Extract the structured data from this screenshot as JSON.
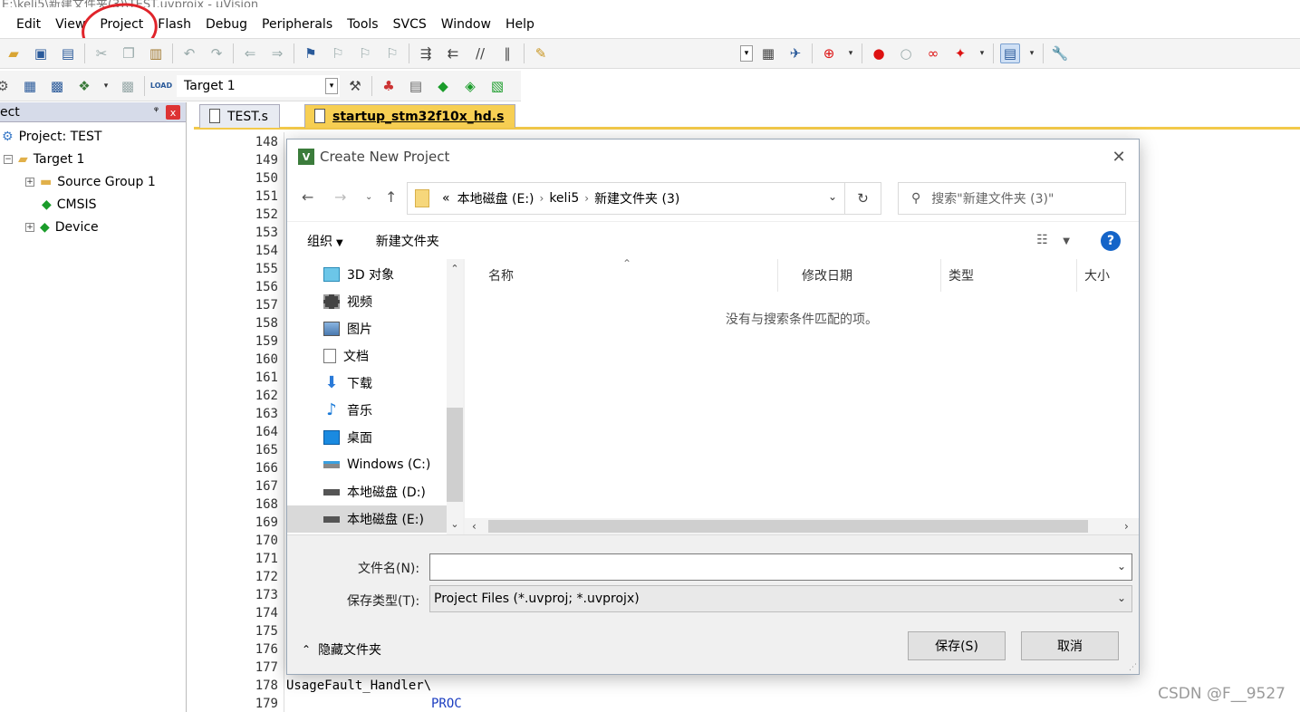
{
  "window": {
    "title": "E:\\keli5\\新建文件夹(3)\\TEST.uvprojx - µVision"
  },
  "menu": [
    "Edit",
    "View",
    "Project",
    "Flash",
    "Debug",
    "Peripherals",
    "Tools",
    "SVCS",
    "Window",
    "Help"
  ],
  "toolbar": {
    "target": "Target 1"
  },
  "project_pane": {
    "title": "ect",
    "pin": "ᵠ",
    "close": "x",
    "tree": {
      "project": "Project: TEST",
      "target": "Target 1",
      "source_group": "Source Group 1",
      "cmsis": "CMSIS",
      "device": "Device"
    }
  },
  "editor": {
    "tabs": [
      {
        "label": "TEST.s",
        "active": false
      },
      {
        "label": "startup_stm32f10x_hd.s",
        "active": true
      }
    ],
    "line_numbers": [
      "148",
      "149",
      "150",
      "151",
      "152",
      "153",
      "154",
      "155",
      "156",
      "157",
      "158",
      "159",
      "160",
      "161",
      "162",
      "163",
      "164",
      "165",
      "166",
      "167",
      "168",
      "169",
      "170",
      "171",
      "172",
      "173",
      "174",
      "175",
      "176",
      "177",
      "178",
      "179"
    ],
    "code": {
      "usage_fault": "UsageFault_Handler\\",
      "proc": "PROC"
    }
  },
  "dialog": {
    "title": "Create New Project",
    "close": "✕",
    "breadcrumb": [
      "本地磁盘 (E:)",
      "keli5",
      "新建文件夹 (3)"
    ],
    "breadcrumb_prefix": "«",
    "search_placeholder": "搜索\"新建文件夹 (3)\"",
    "commands": {
      "organize": "组织",
      "new_folder": "新建文件夹"
    },
    "help": "?",
    "nav_items": [
      {
        "label": "3D 对象",
        "icon": "cube-icon"
      },
      {
        "label": "视频",
        "icon": "video-icon"
      },
      {
        "label": "图片",
        "icon": "picture-icon"
      },
      {
        "label": "文档",
        "icon": "document-icon"
      },
      {
        "label": "下载",
        "icon": "download-icon"
      },
      {
        "label": "音乐",
        "icon": "music-icon"
      },
      {
        "label": "桌面",
        "icon": "desktop-icon"
      },
      {
        "label": "Windows (C:)",
        "icon": "drive-icon"
      },
      {
        "label": "本地磁盘 (D:)",
        "icon": "drive-icon"
      },
      {
        "label": "本地磁盘 (E:)",
        "icon": "drive-icon",
        "selected": true
      }
    ],
    "columns": [
      "名称",
      "修改日期",
      "类型",
      "大小"
    ],
    "empty_message": "没有与搜索条件匹配的项。",
    "filename_label": "文件名(N):",
    "filename_value": "",
    "filetype_label": "保存类型(T):",
    "filetype_value": "Project Files (*.uvproj; *.uvprojx)",
    "hide_folders": "隐藏文件夹",
    "save_button": "保存(S)",
    "cancel_button": "取消"
  },
  "watermark": "CSDN @F__9527",
  "colors": {
    "tab_active": "#f7cf53",
    "help_blue": "#1464c8",
    "annotation_red": "#e0242a",
    "keyword_blue": "#1a3cc0"
  }
}
